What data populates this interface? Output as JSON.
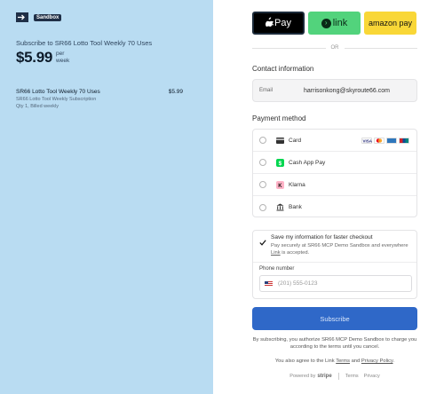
{
  "brand": {
    "sandbox_badge": "Sandbox",
    "logo_icon": "arrow-logo-icon"
  },
  "summary": {
    "subscribe_title": "Subscribe to SR66 Lotto Tool Weekly 70 Uses",
    "price": "$5.99",
    "per": "per",
    "period": "week",
    "line_item": {
      "name": "SR66 Lotto Tool Weekly 70 Uses",
      "amount": "$5.99",
      "subtitle": "SR66 Lotto Tool Weekly Subscription",
      "qty": "Qty 1, Billed weekly"
    }
  },
  "wallets": {
    "apple_label": "Pay",
    "link_label": "link",
    "amazon_label": "amazon pay"
  },
  "or_text": "OR",
  "contact": {
    "title": "Contact information",
    "email_label": "Email",
    "email_value": "harrisonkong@skyroute66.com"
  },
  "payment": {
    "title": "Payment method",
    "options": [
      {
        "label": "Card",
        "icon": "card-icon"
      },
      {
        "label": "Cash App Pay",
        "icon": "cash-app-icon"
      },
      {
        "label": "Klarna",
        "icon": "klarna-icon"
      },
      {
        "label": "Bank",
        "icon": "bank-icon"
      }
    ],
    "card_brands": [
      "visa",
      "mastercard",
      "amex",
      "union-pay"
    ]
  },
  "save_info": {
    "title": "Save my information for faster checkout",
    "desc_prefix": "Pay securely at SR66 MCP Demo Sandbox and everywhere ",
    "desc_link": "Link",
    "desc_suffix": " is accepted.",
    "checked": true,
    "phone_label": "Phone number",
    "phone_placeholder": "(201) 555-0123"
  },
  "subscribe_button": "Subscribe",
  "terms": {
    "line1": "By subscribing, you authorize SR66 MCP Demo Sandbox to charge you according to the terms until you cancel.",
    "line2_prefix": "You also agree to the Link ",
    "terms_link": "Terms",
    "and": " and ",
    "privacy_link": "Privacy Policy",
    "period": "."
  },
  "footer": {
    "powered_by": "Powered by",
    "stripe": "stripe",
    "terms": "Terms",
    "privacy": "Privacy"
  },
  "colors": {
    "left_bg": "#b9dcf2",
    "subscribe_bg": "#2f68c8",
    "link_green": "#52d37c",
    "amazon_yellow": "#f9d737"
  }
}
